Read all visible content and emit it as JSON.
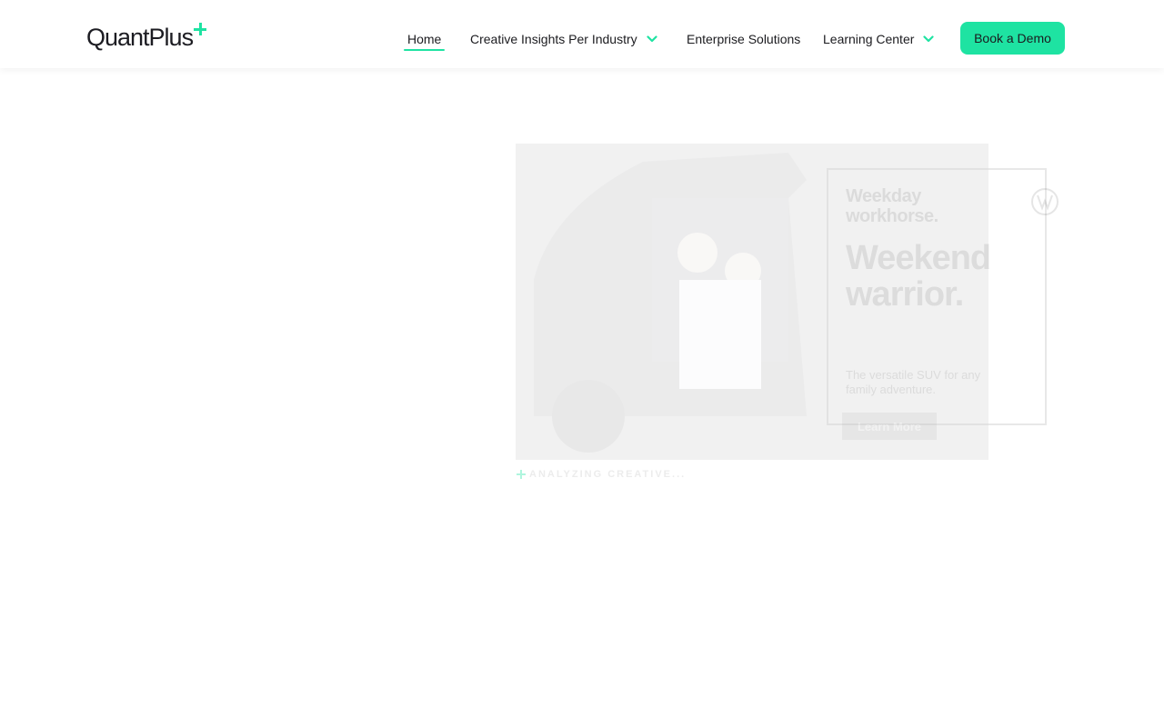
{
  "header": {
    "logo_text": "QuantPlus",
    "nav": {
      "home": "Home",
      "insights": "Creative Insights Per Industry",
      "enterprise": "Enterprise Solutions",
      "learning": "Learning Center"
    },
    "cta_label": "Book a Demo"
  },
  "creative_preview": {
    "subheadline": "Weekday workhorse.",
    "headline": "Weekend warrior.",
    "body": "The versatile SUV for any family adventure.",
    "cta_label": "Learn More",
    "brand_icon": "vw-logo-icon",
    "status_text": "ANALYZING CREATIVE..."
  },
  "colors": {
    "accent": "#1ee3a2",
    "text": "#1b1b1f",
    "background": "#ffffff"
  },
  "icons": {
    "chevron": "chevron-down-icon",
    "plus": "plus-icon"
  }
}
